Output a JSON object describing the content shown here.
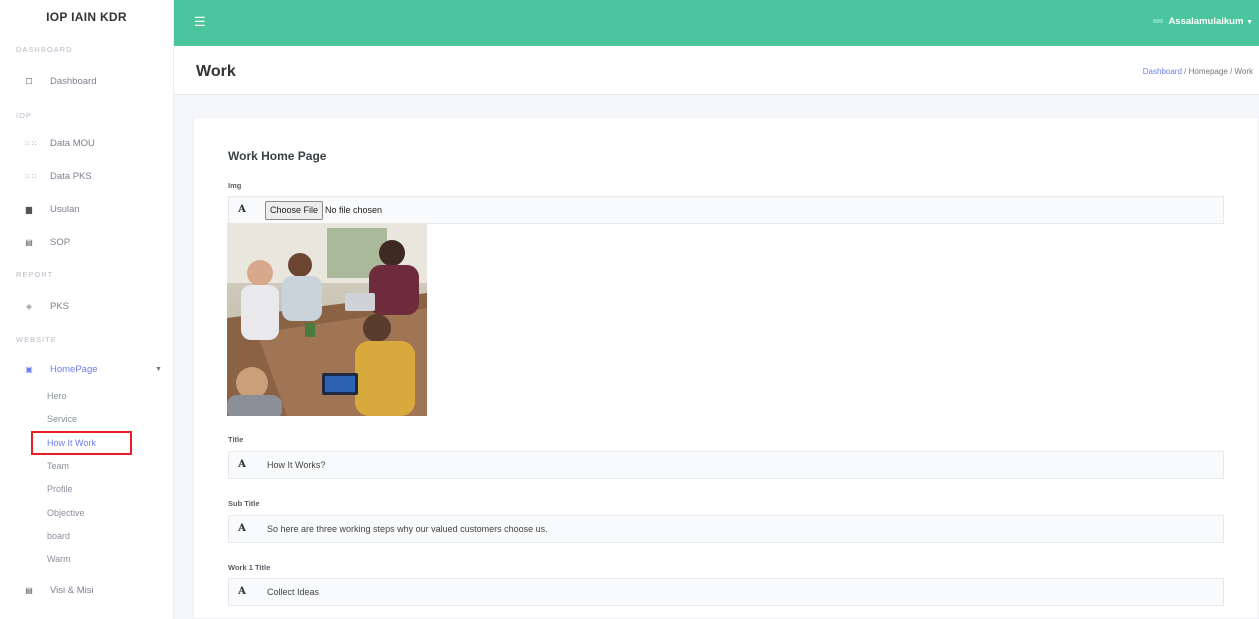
{
  "app": {
    "brand": "IOP IAIN KDR"
  },
  "sidebar": {
    "sections": [
      "DASHBOARD",
      "IOP",
      "REPORT",
      "WEBSITE"
    ],
    "items": {
      "dashboard": "Dashboard",
      "data_mou": "Data MOU",
      "data_pks": "Data PKS",
      "usulan": "Usulan",
      "sop": "SOP",
      "pks": "PKS",
      "homepage": "HomePage",
      "visi_misi": "Visi & Misi"
    },
    "homepage_sub": [
      "Hero",
      "Service",
      "How It Work",
      "Team",
      "Profile",
      "Objective",
      "board",
      "Warm"
    ],
    "active_sub": "How It Work"
  },
  "topbar": {
    "user_greeting": "Assalamulaikum"
  },
  "page": {
    "title": "Work",
    "breadcrumb": {
      "home": "Dashboard",
      "sep1": "/",
      "mid": "Homepage",
      "sep2": "/",
      "current": "Work"
    }
  },
  "form": {
    "card_title": "Work Home Page",
    "addon_glyph": "A",
    "img": {
      "label": "Img",
      "button": "Choose File",
      "status": "No file chosen"
    },
    "title": {
      "label": "Title",
      "value": "How It Works?"
    },
    "subtitle": {
      "label": "Sub Title",
      "value": "So here are three working steps why our valued customers choose us."
    },
    "work1": {
      "label": "Work 1 Title",
      "value": "Collect Ideas"
    }
  },
  "colors": {
    "topbar": "#4bc59d",
    "accent": "#6a7ef0",
    "highlight": "#ee1c24"
  }
}
